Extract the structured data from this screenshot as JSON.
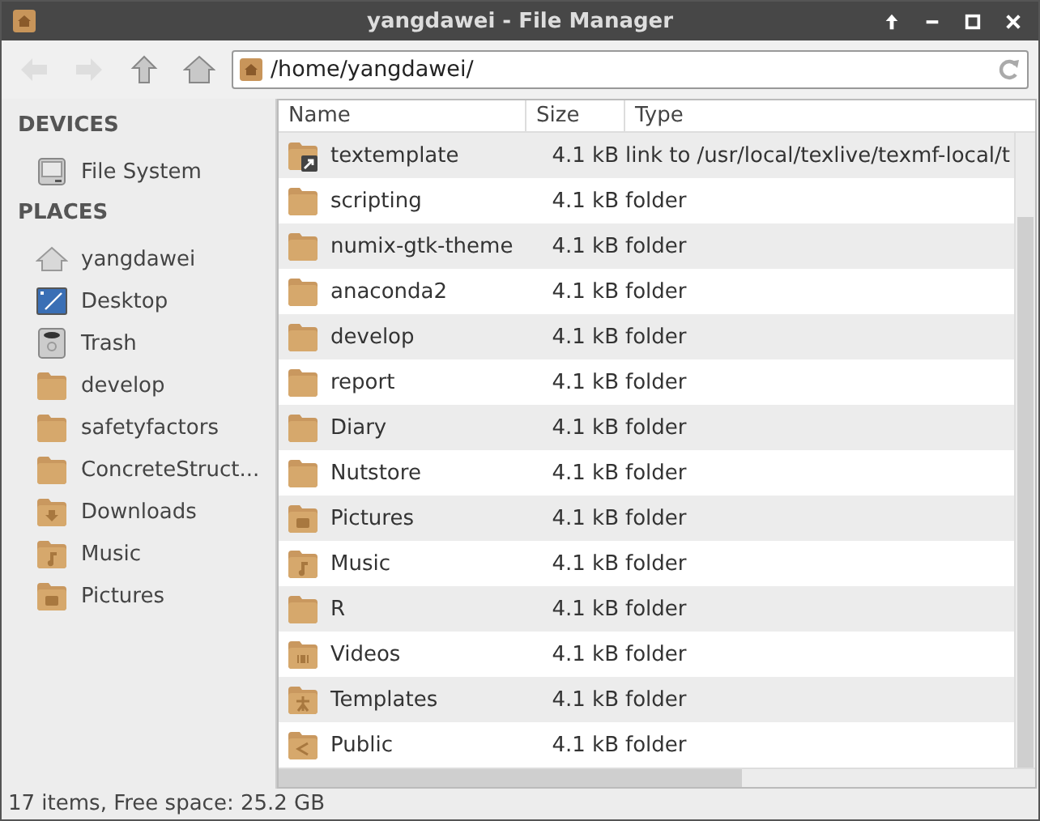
{
  "window": {
    "title": "yangdawei - File Manager"
  },
  "toolbar": [
    {
      "kind": "back",
      "disabled": true
    },
    {
      "kind": "forward",
      "disabled": true
    },
    {
      "kind": "up",
      "disabled": false
    },
    {
      "kind": "home",
      "disabled": false
    }
  ],
  "location": {
    "value": "/home/yangdawei/"
  },
  "sidebar": [
    {
      "heading": "DEVICES",
      "items": [
        {
          "label": "File System",
          "kind": "drive"
        }
      ]
    },
    {
      "heading": "PLACES",
      "items": [
        {
          "label": "yangdawei",
          "kind": "home"
        },
        {
          "label": "Desktop",
          "kind": "desktop"
        },
        {
          "label": "Trash",
          "kind": "trash"
        },
        {
          "label": "develop",
          "kind": "folder"
        },
        {
          "label": "safetyfactors",
          "kind": "folder"
        },
        {
          "label": "ConcreteStruct...",
          "kind": "folder"
        },
        {
          "label": "Downloads",
          "kind": "downloads"
        },
        {
          "label": "Music",
          "kind": "music"
        },
        {
          "label": "Pictures",
          "kind": "pictures"
        }
      ]
    }
  ],
  "table": {
    "columns": [
      "Name",
      "Size",
      "Type"
    ],
    "rows": [
      {
        "name": "textemplate",
        "size": "4.1 kB",
        "type": "link to /usr/local/texlive/texmf-local/t",
        "kind": "link"
      },
      {
        "name": "scripting",
        "size": "4.1 kB",
        "type": "folder",
        "kind": "folder"
      },
      {
        "name": "numix-gtk-theme",
        "size": "4.1 kB",
        "type": "folder",
        "kind": "folder"
      },
      {
        "name": "anaconda2",
        "size": "4.1 kB",
        "type": "folder",
        "kind": "folder"
      },
      {
        "name": "develop",
        "size": "4.1 kB",
        "type": "folder",
        "kind": "folder"
      },
      {
        "name": "report",
        "size": "4.1 kB",
        "type": "folder",
        "kind": "folder"
      },
      {
        "name": "Diary",
        "size": "4.1 kB",
        "type": "folder",
        "kind": "folder"
      },
      {
        "name": "Nutstore",
        "size": "4.1 kB",
        "type": "folder",
        "kind": "folder"
      },
      {
        "name": "Pictures",
        "size": "4.1 kB",
        "type": "folder",
        "kind": "pictures"
      },
      {
        "name": "Music",
        "size": "4.1 kB",
        "type": "folder",
        "kind": "music"
      },
      {
        "name": "R",
        "size": "4.1 kB",
        "type": "folder",
        "kind": "folder"
      },
      {
        "name": "Videos",
        "size": "4.1 kB",
        "type": "folder",
        "kind": "videos"
      },
      {
        "name": "Templates",
        "size": "4.1 kB",
        "type": "folder",
        "kind": "templates"
      },
      {
        "name": "Public",
        "size": "4.1 kB",
        "type": "folder",
        "kind": "public"
      }
    ]
  },
  "status_bar": "17 items, Free space: 25.2 GB"
}
